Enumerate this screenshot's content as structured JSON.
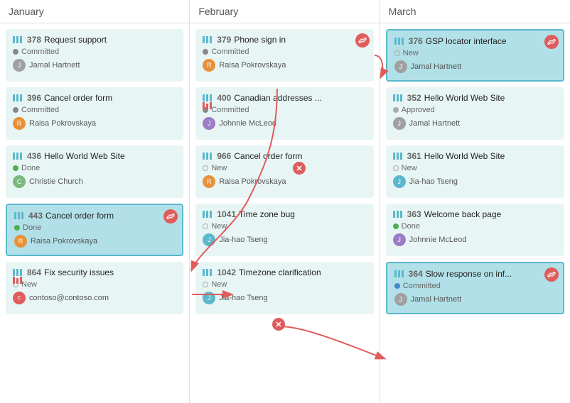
{
  "columns": [
    {
      "id": "january",
      "label": "January",
      "cards": [
        {
          "id": "378",
          "name": "Request support",
          "status": "Committed",
          "status_type": "committed",
          "assignee": "Jamal Hartnett",
          "avatar_color": "gray",
          "avatar_letter": "J",
          "has_link": false,
          "highlighted": false
        },
        {
          "id": "396",
          "name": "Cancel order form",
          "status": "Committed",
          "status_type": "committed",
          "assignee": "Raisa Pokrovskaya",
          "avatar_color": "orange",
          "avatar_letter": "R",
          "has_link": false,
          "highlighted": false
        },
        {
          "id": "436",
          "name": "Hello World Web Site",
          "status": "Done",
          "status_type": "done",
          "assignee": "Christie Church",
          "avatar_color": "green",
          "avatar_letter": "C",
          "has_link": false,
          "highlighted": false
        },
        {
          "id": "443",
          "name": "Cancel order form",
          "status": "Done",
          "status_type": "done",
          "assignee": "Raisa Pokrovskaya",
          "avatar_color": "orange",
          "avatar_letter": "R",
          "has_link": true,
          "highlighted": true
        },
        {
          "id": "864",
          "name": "Fix security issues",
          "status": "New",
          "status_type": "new",
          "assignee": "contoso@contoso.com",
          "avatar_color": "red",
          "avatar_letter": "C",
          "has_link": false,
          "highlighted": false
        }
      ]
    },
    {
      "id": "february",
      "label": "February",
      "cards": [
        {
          "id": "379",
          "name": "Phone sign in",
          "status": "Committed",
          "status_type": "committed",
          "assignee": "Raisa Pokrovskaya",
          "avatar_color": "orange",
          "avatar_letter": "R",
          "has_link": true,
          "highlighted": false
        },
        {
          "id": "400",
          "name": "Canadian addresses ...",
          "status": "Committed",
          "status_type": "committed",
          "assignee": "Johnnie McLeod",
          "avatar_color": "purple",
          "avatar_letter": "J",
          "has_link": false,
          "highlighted": false
        },
        {
          "id": "966",
          "name": "Cancel order form",
          "status": "New",
          "status_type": "new",
          "assignee": "Raisa Pokrovskaya",
          "avatar_color": "orange",
          "avatar_letter": "R",
          "has_link": false,
          "highlighted": false
        },
        {
          "id": "1041",
          "name": "Time zone bug",
          "status": "New",
          "status_type": "new",
          "assignee": "Jia-hao Tseng",
          "avatar_color": "teal",
          "avatar_letter": "J",
          "has_link": false,
          "highlighted": false
        },
        {
          "id": "1042",
          "name": "Timezone clarification",
          "status": "New",
          "status_type": "new",
          "assignee": "Jia-hao Tseng",
          "avatar_color": "teal",
          "avatar_letter": "J",
          "has_link": false,
          "highlighted": false
        }
      ]
    },
    {
      "id": "march",
      "label": "March",
      "cards": [
        {
          "id": "376",
          "name": "GSP locator interface",
          "status": "New",
          "status_type": "new",
          "assignee": "Jamal Hartnett",
          "avatar_color": "gray",
          "avatar_letter": "J",
          "has_link": true,
          "highlighted": true
        },
        {
          "id": "352",
          "name": "Hello World Web Site",
          "status": "Approved",
          "status_type": "approved",
          "assignee": "Jamal Hartnett",
          "avatar_color": "gray",
          "avatar_letter": "J",
          "has_link": false,
          "highlighted": false
        },
        {
          "id": "361",
          "name": "Hello World Web Site",
          "status": "New",
          "status_type": "new",
          "assignee": "Jia-hao Tseng",
          "avatar_color": "teal",
          "avatar_letter": "J",
          "has_link": false,
          "highlighted": false
        },
        {
          "id": "363",
          "name": "Welcome back page",
          "status": "Done",
          "status_type": "done",
          "assignee": "Johnnie McLeod",
          "avatar_color": "purple",
          "avatar_letter": "J",
          "has_link": false,
          "highlighted": false
        },
        {
          "id": "364",
          "name": "Slow response on inf...",
          "status": "Committed",
          "status_type": "committed",
          "assignee": "Jamal Hartnett",
          "avatar_color": "gray",
          "avatar_letter": "J",
          "has_link": true,
          "highlighted": true
        }
      ]
    }
  ],
  "link_icon_symbol": "🔗",
  "cross_symbol": "✕"
}
